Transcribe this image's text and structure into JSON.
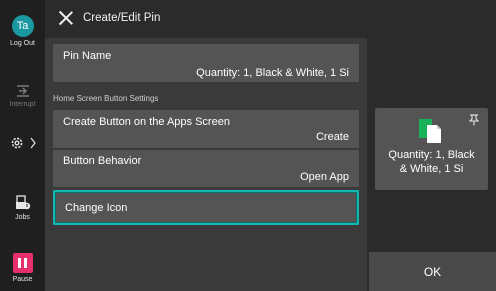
{
  "rail": {
    "avatar_initials": "Ta",
    "logout_label": "Log Out",
    "interrupt_label": "Interrupt",
    "jobs_label": "Jobs",
    "pause_label": "Pause"
  },
  "header": {
    "title": "Create/Edit Pin"
  },
  "main": {
    "pin_name": {
      "title": "Pin Name",
      "value": "Quantity: 1, Black & White, 1 Si"
    },
    "section_label": "Home Screen Button Settings",
    "create_button": {
      "title": "Create Button on the Apps Screen",
      "value": "Create"
    },
    "button_behavior": {
      "title": "Button Behavior",
      "value": "Open App"
    },
    "change_icon": {
      "title": "Change Icon"
    }
  },
  "preview": {
    "line1": "Quantity: 1, Black",
    "line2": "& White, 1 Si"
  },
  "ok_label": "OK",
  "colors": {
    "accent": "#14b8b0",
    "avatar": "#1a9aa0",
    "pause": "#e5306b",
    "doc_green": "#19b25a"
  }
}
